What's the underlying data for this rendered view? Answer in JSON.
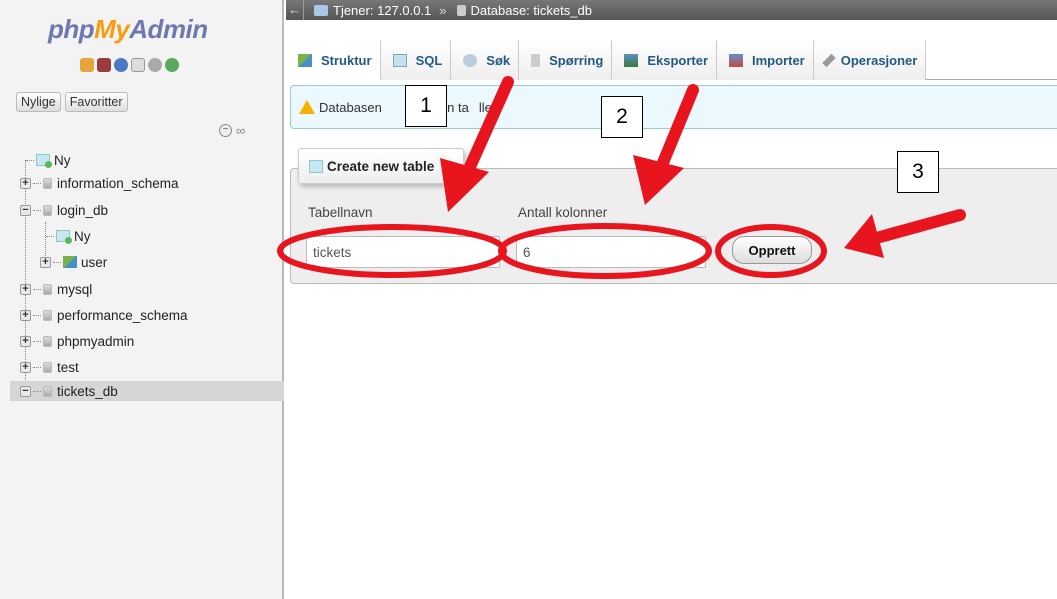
{
  "logo": {
    "part1": "php",
    "part2": "My",
    "part3": "Admin"
  },
  "nav": {
    "tabs": [
      "Nylige",
      "Favoritter"
    ],
    "tree": {
      "new": "Ny",
      "databases": [
        {
          "name": "information_schema"
        },
        {
          "name": "login_db",
          "children": [
            {
              "name": "Ny"
            },
            {
              "name": "user"
            }
          ]
        },
        {
          "name": "mysql"
        },
        {
          "name": "performance_schema"
        },
        {
          "name": "phpmyadmin"
        },
        {
          "name": "test"
        },
        {
          "name": "tickets_db"
        }
      ]
    }
  },
  "breadcrumb": {
    "server": "Tjener: 127.0.0.1",
    "sep": "»",
    "database": "Database: tickets_db"
  },
  "tabs": [
    "Struktur",
    "SQL",
    "Søk",
    "Spørring",
    "Eksporter",
    "Importer",
    "Operasjoner"
  ],
  "notice": {
    "text_start": "Databasen",
    "text_mid": "en ta",
    "text_end": "ller."
  },
  "create_table": {
    "legend": "Create new table",
    "name_label": "Tabellnavn",
    "name_value": "tickets",
    "cols_label": "Antall kolonner",
    "cols_value": "6",
    "button": "Opprett"
  },
  "annotations": [
    "1",
    "2",
    "3"
  ],
  "colors": {
    "annotation": "#e8141e",
    "link": "#235a81",
    "topbar": "#666666"
  }
}
